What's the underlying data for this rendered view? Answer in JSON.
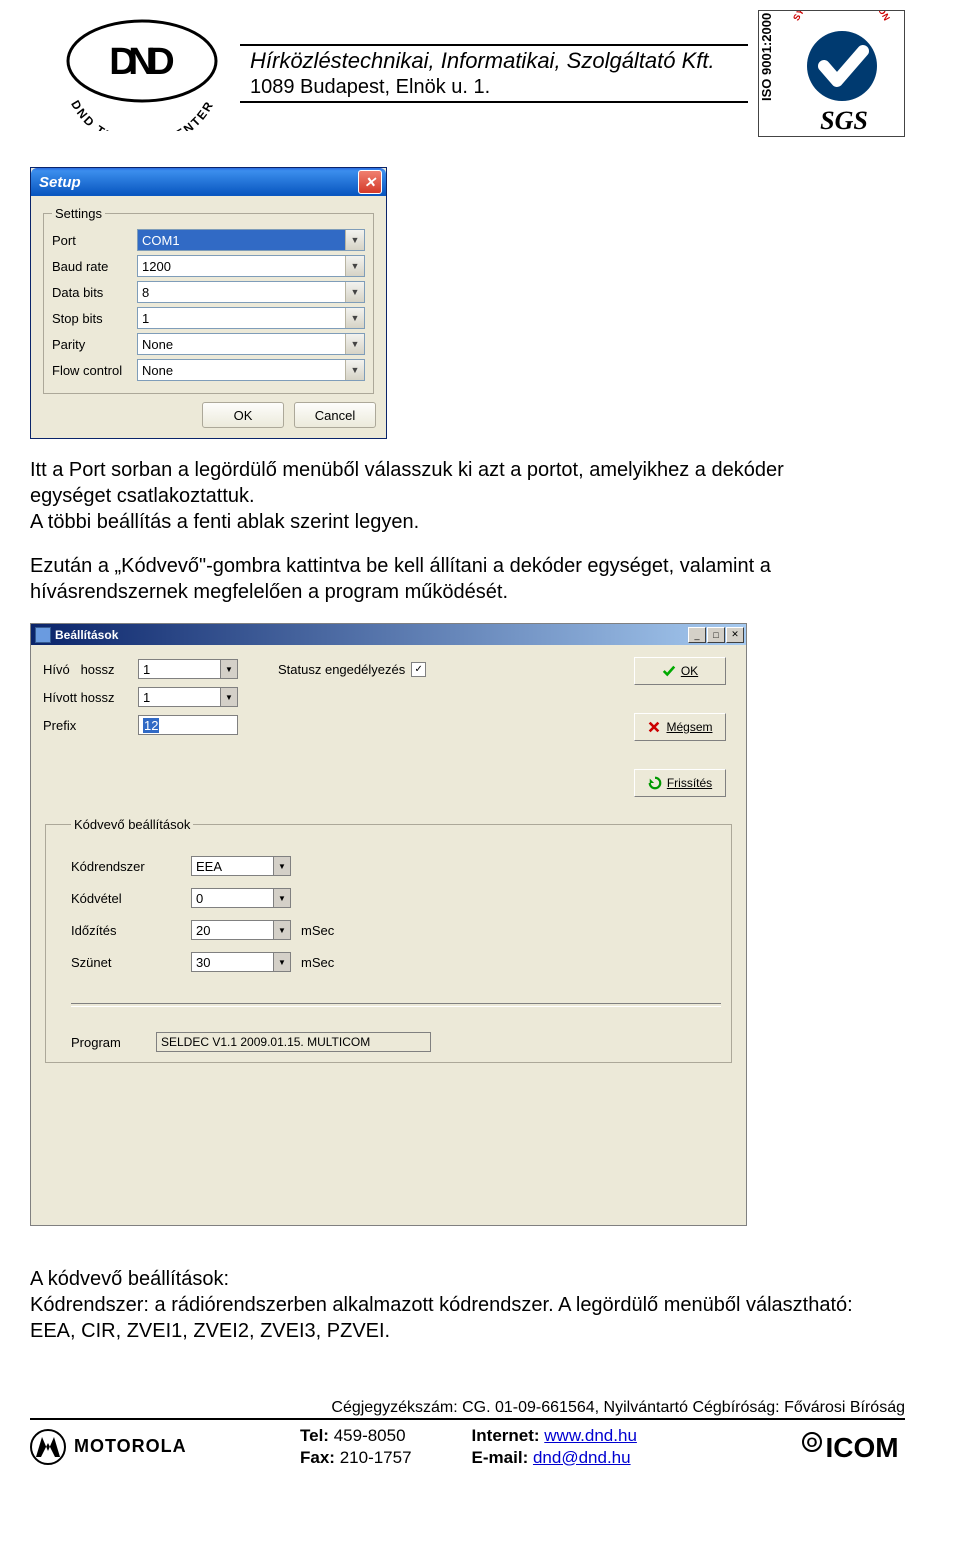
{
  "header": {
    "company_line": "Hírközléstechnikai, Informatikai, Szolgáltató Kft.",
    "address_line": "1089 Budapest, Elnök u. 1.",
    "dnd_logo_text_top": "DND",
    "dnd_logo_text_bottom": "TELECOM CENTER",
    "sgs_top": "SYSTEM CERTIFICATION",
    "sgs_side": "ISO 9001:2000",
    "sgs_brand": "SGS"
  },
  "setup": {
    "title": "Setup",
    "legend": "Settings",
    "rows": {
      "port": {
        "label": "Port",
        "value": "COM1"
      },
      "baud": {
        "label": "Baud rate",
        "value": "1200"
      },
      "databits": {
        "label": "Data bits",
        "value": "8"
      },
      "stopbits": {
        "label": "Stop bits",
        "value": "1"
      },
      "parity": {
        "label": "Parity",
        "value": "None"
      },
      "flow": {
        "label": "Flow control",
        "value": "None"
      }
    },
    "ok": "OK",
    "cancel": "Cancel"
  },
  "para1": "Itt a Port sorban a legördülő menüből válasszuk ki azt a portot, amelyikhez a dekóder egységet csatlakoztattuk.\nA többi beállítás a fenti ablak szerint legyen.",
  "para2": "Ezután a „Kódvevő\"-gombra kattintva be kell állítani a dekóder egységet, valamint a hívásrendszernek megfelelően a program működését.",
  "beall": {
    "title": "Beállítások",
    "hivo_label": "Hívó   hossz",
    "hivo_value": "1",
    "hivott_label": "Hívott hossz",
    "hivott_value": "1",
    "prefix_label": "Prefix",
    "prefix_value": "12",
    "status_label": "Statusz engedélyezés",
    "status_checked": "✓",
    "btn_ok": "OK",
    "btn_cancel": "Mégsem",
    "btn_refresh": "Frissítés",
    "kodvevo_legend": "Kódvevő beállítások",
    "kodrendszer_label": "Kódrendszer",
    "kodrendszer_value": "EEA",
    "kodvetel_label": "Kódvétel",
    "kodvetel_value": "0",
    "idozites_label": "Időzítés",
    "idozites_value": "20",
    "idozites_unit": "mSec",
    "szunet_label": "Szünet",
    "szunet_value": "30",
    "szunet_unit": "mSec",
    "program_label": "Program",
    "program_value": "SELDEC V1.1 2009.01.15. MULTICOM"
  },
  "para3": "A kódvevő beállítások:\nKódrendszer: a rádiórendszerben alkalmazott kódrendszer. A legördülő menüből választható: EEA, CIR, ZVEI1, ZVEI2, ZVEI3, PZVEI.",
  "footer": {
    "reg": "Cégjegyzékszám: CG. 01-09-661564, Nyilvántartó Cégbíróság: Fővárosi Bíróság",
    "motorola": "MOTOROLA",
    "tel_label": "Tel:",
    "tel_value": "459-8050",
    "fax_label": "Fax:",
    "fax_value": "210-1757",
    "internet_label": "Internet:",
    "internet_value": "www.dnd.hu",
    "email_label": "E-mail:",
    "email_value": "dnd@dnd.hu",
    "icom": "ICOM"
  }
}
